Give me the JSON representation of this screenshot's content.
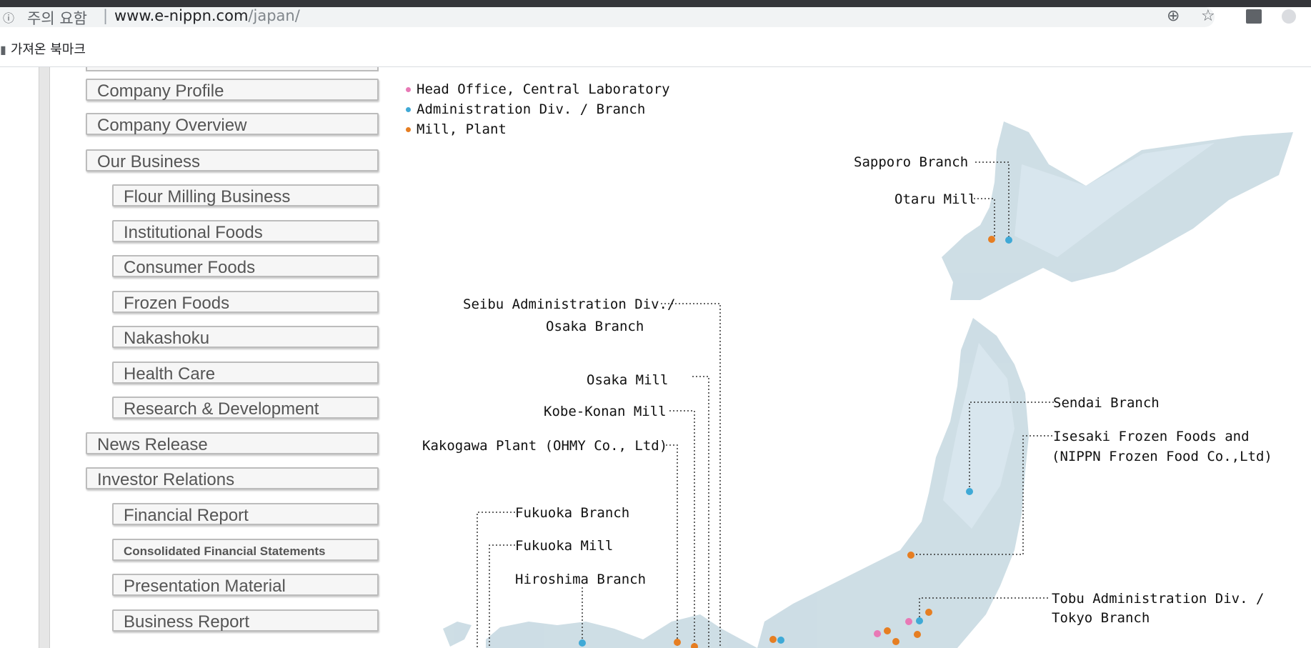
{
  "browser": {
    "security_label": "주의 요함",
    "url_host": "www.e-nippn.com",
    "url_path": "/japan/",
    "bookmarks_folder": "가져온 북마크"
  },
  "nav": {
    "items": [
      {
        "label": "Company Profile"
      },
      {
        "label": "Company Overview"
      },
      {
        "label": "Our Business"
      },
      {
        "label": "Flour Milling Business"
      },
      {
        "label": "Institutional Foods"
      },
      {
        "label": "Consumer Foods"
      },
      {
        "label": "Frozen Foods"
      },
      {
        "label": "Nakashoku"
      },
      {
        "label": "Health Care"
      },
      {
        "label": "Research & Development"
      },
      {
        "label": "News Release"
      },
      {
        "label": "Investor Relations"
      },
      {
        "label": "Financial Report"
      },
      {
        "label": "Consolidated Financial Statements"
      },
      {
        "label": "Presentation Material"
      },
      {
        "label": "Business Report"
      }
    ]
  },
  "legend": {
    "items": [
      {
        "label": "Head Office, Central Laboratory",
        "color": "#e879b6"
      },
      {
        "label": "Administration Div. / Branch",
        "color": "#3fa9d6"
      },
      {
        "label": "Mill, Plant",
        "color": "#e67e22"
      }
    ]
  },
  "map": {
    "labels": {
      "sapporo": "Sapporo Branch",
      "otaru": "Otaru Mill",
      "seibu_1": "Seibu Administration Div./",
      "seibu_2": "Osaka Branch",
      "osaka_mill": "Osaka Mill",
      "kobe": "Kobe-Konan Mill",
      "kakogawa": "Kakogawa Plant (OHMY Co., Ltd)",
      "sendai": "Sendai Branch",
      "isesaki_1": "Isesaki Frozen Foods and",
      "isesaki_2": "(NIPPN Frozen Food Co.,Ltd)",
      "fukuoka_branch": "Fukuoka Branch",
      "fukuoka_mill": "Fukuoka Mill",
      "hiroshima": "Hiroshima Branch",
      "tobu_1": "Tobu Administration Div. /",
      "tobu_2": "Tokyo Branch"
    }
  }
}
